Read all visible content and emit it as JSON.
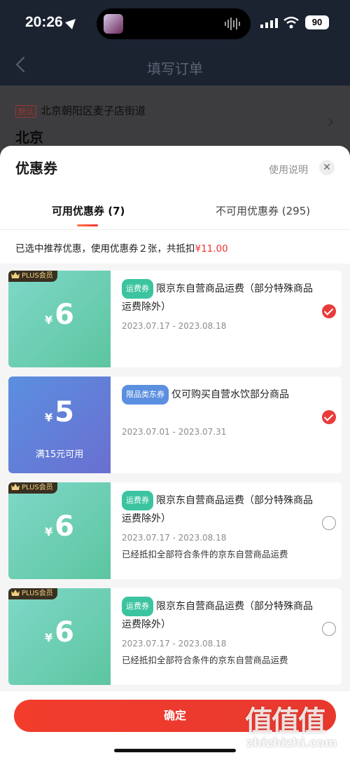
{
  "status_bar": {
    "time": "20:26",
    "battery": "90",
    "icons": [
      "location-icon",
      "audio-wave-icon",
      "signal-icon",
      "wifi-icon",
      "battery-icon"
    ]
  },
  "page": {
    "title": "填写订单",
    "address_tag": "默认",
    "address_line": "北京朝阳区麦子店街道",
    "city": "北京"
  },
  "sheet": {
    "title": "优惠券",
    "help_link": "使用说明",
    "close_label": "✕",
    "tabs": [
      {
        "label": "可用优惠券 (7)",
        "active": true
      },
      {
        "label": "不可用优惠券 (295)",
        "active": false
      }
    ],
    "summary_prefix": "已选中推荐优惠，使用优惠券２张，共抵扣",
    "summary_amount": "¥11.00",
    "confirm_label": "确定"
  },
  "coupons": [
    {
      "badge": "PLUS会员",
      "currency": "¥",
      "value": "6",
      "condition": "",
      "tag": "运费券",
      "desc": "限京东自营商品运费（部分特殊商品运费除外）",
      "date": "2023.07.17 - 2023.08.18",
      "note": "",
      "selected": true
    },
    {
      "badge": "",
      "currency": "¥",
      "value": "5",
      "condition": "满15元可用",
      "tag": "限品类东券",
      "desc": "仅可购买自营水饮部分商品",
      "date": "2023.07.01 - 2023.07.31",
      "note": "",
      "selected": true
    },
    {
      "badge": "PLUS会员",
      "currency": "¥",
      "value": "6",
      "condition": "",
      "tag": "运费券",
      "desc": "限京东自营商品运费（部分特殊商品运费除外）",
      "date": "2023.07.17 - 2023.08.18",
      "note": "已经抵扣全部符合条件的京东自营商品运费",
      "selected": false
    },
    {
      "badge": "PLUS会员",
      "currency": "¥",
      "value": "6",
      "condition": "",
      "tag": "运费券",
      "desc": "限京东自营商品运费（部分特殊商品运费除外）",
      "date": "2023.07.17 - 2023.08.18",
      "note": "已经抵扣全部符合条件的京东自营商品运费",
      "selected": false
    }
  ],
  "watermark": {
    "logo": "值值值",
    "text": "zhizhizhi.com"
  },
  "colors": {
    "accent": "#f23030",
    "tag_green": "#3cc4a0",
    "tag_blue": "#5b8fe0"
  }
}
